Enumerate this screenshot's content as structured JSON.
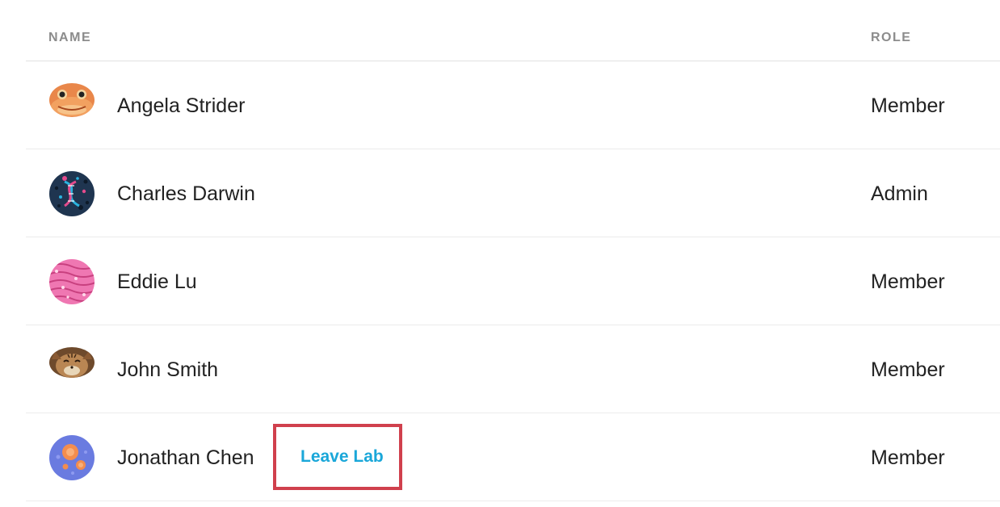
{
  "table": {
    "headers": {
      "name": "NAME",
      "role": "ROLE"
    },
    "members": [
      {
        "name": "Angela Strider",
        "role": "Member",
        "avatar": "gecko-avatar"
      },
      {
        "name": "Charles Darwin",
        "role": "Admin",
        "avatar": "dna-avatar"
      },
      {
        "name": "Eddie Lu",
        "role": "Member",
        "avatar": "pink-pattern-avatar"
      },
      {
        "name": "John Smith",
        "role": "Member",
        "avatar": "cat-avatar"
      },
      {
        "name": "Jonathan Chen",
        "role": "Member",
        "avatar": "cells-avatar",
        "action": "Leave Lab"
      }
    ]
  },
  "colors": {
    "header_text": "#8c8c8c",
    "link": "#1aa7d9",
    "highlight_border": "#d0404d",
    "divider": "#ececec"
  }
}
